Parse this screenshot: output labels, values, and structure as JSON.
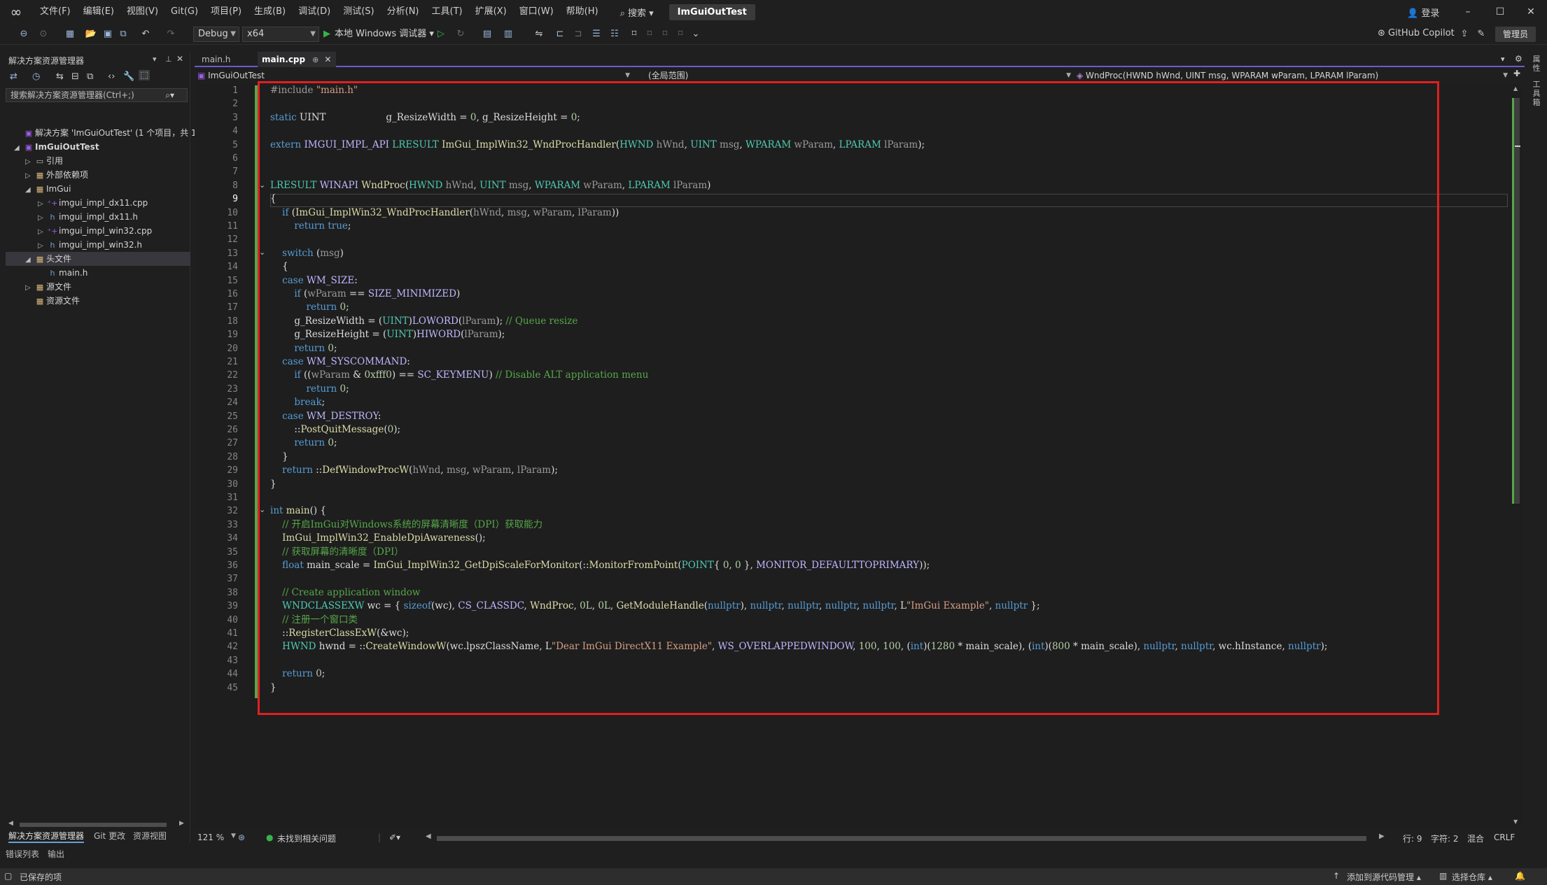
{
  "titlebar": {
    "menus": [
      "文件(F)",
      "编辑(E)",
      "视图(V)",
      "Git(G)",
      "项目(P)",
      "生成(B)",
      "调试(D)",
      "测试(S)",
      "分析(N)",
      "工具(T)",
      "扩展(X)",
      "窗口(W)",
      "帮助(H)"
    ],
    "search_label": "⌕ 搜索 ▾",
    "solution_title": "ImGuiOutTest",
    "login_label": "登录"
  },
  "toolbar": {
    "config": "Debug",
    "platform": "x64",
    "run_label": "本地 Windows 调试器 ▾",
    "copilot_label": "GitHub Copilot",
    "admin_label": "管理员"
  },
  "solution_explorer": {
    "title": "解决方案资源管理器",
    "search_placeholder": "搜索解决方案资源管理器(Ctrl+;)",
    "items": [
      {
        "label": "解决方案 'ImGuiOutTest' (1 个项目，共 1",
        "icon": "solution-icon"
      },
      {
        "label": "ImGuiOutTest",
        "icon": "project-icon"
      },
      {
        "label": "引用",
        "icon": "references-icon"
      },
      {
        "label": "外部依赖项",
        "icon": "external-deps-icon"
      },
      {
        "label": "ImGui",
        "icon": "folder-icon"
      },
      {
        "label": "imgui_impl_dx11.cpp",
        "icon": "cpp-file-icon"
      },
      {
        "label": "imgui_impl_dx11.h",
        "icon": "header-file-icon"
      },
      {
        "label": "imgui_impl_win32.cpp",
        "icon": "cpp-file-icon"
      },
      {
        "label": "imgui_impl_win32.h",
        "icon": "header-file-icon"
      },
      {
        "label": "头文件",
        "icon": "folder-icon"
      },
      {
        "label": "main.h",
        "icon": "header-file-icon"
      },
      {
        "label": "源文件",
        "icon": "folder-icon"
      },
      {
        "label": "资源文件",
        "icon": "folder-icon"
      }
    ],
    "tabs": [
      "解决方案资源管理器",
      "Git 更改",
      "资源视图"
    ],
    "bottom_tabs": [
      "错误列表",
      "输出"
    ]
  },
  "editor": {
    "tabs": [
      {
        "label": "main.h",
        "active": false
      },
      {
        "label": "main.cpp",
        "active": true
      }
    ],
    "nav_project": "ImGuiOutTest",
    "nav_scope": "(全局范围)",
    "nav_member": "WndProc(HWND hWnd, UINT msg, WPARAM wParam, LPARAM lParam)",
    "line_numbers": [
      "1",
      "2",
      "3",
      "4",
      "5",
      "6",
      "7",
      "8",
      "9",
      "10",
      "11",
      "12",
      "13",
      "14",
      "15",
      "16",
      "17",
      "18",
      "19",
      "20",
      "21",
      "22",
      "23",
      "24",
      "25",
      "26",
      "27",
      "28",
      "29",
      "30",
      "31",
      "32",
      "33",
      "34",
      "35",
      "36",
      "37",
      "38",
      "39",
      "40",
      "41",
      "42",
      "43",
      "44",
      "45"
    ],
    "current_line": 9,
    "zoom": "121 %",
    "issues": "未找到相关问题",
    "line_label": "行: 9",
    "char_label": "字符: 2",
    "mode": "混合",
    "eol": "CRLF"
  },
  "statusbar": {
    "saved": "已保存的项",
    "add_source": "添加到源代码管理 ▴",
    "select_repo": "选择仓库 ▴"
  },
  "right_strip": {
    "labels": [
      "属性",
      "工具箱"
    ]
  },
  "colors": {
    "accent": "#6a5acd",
    "highlight_box": "#e02020",
    "change_bar": "#57a64a"
  }
}
